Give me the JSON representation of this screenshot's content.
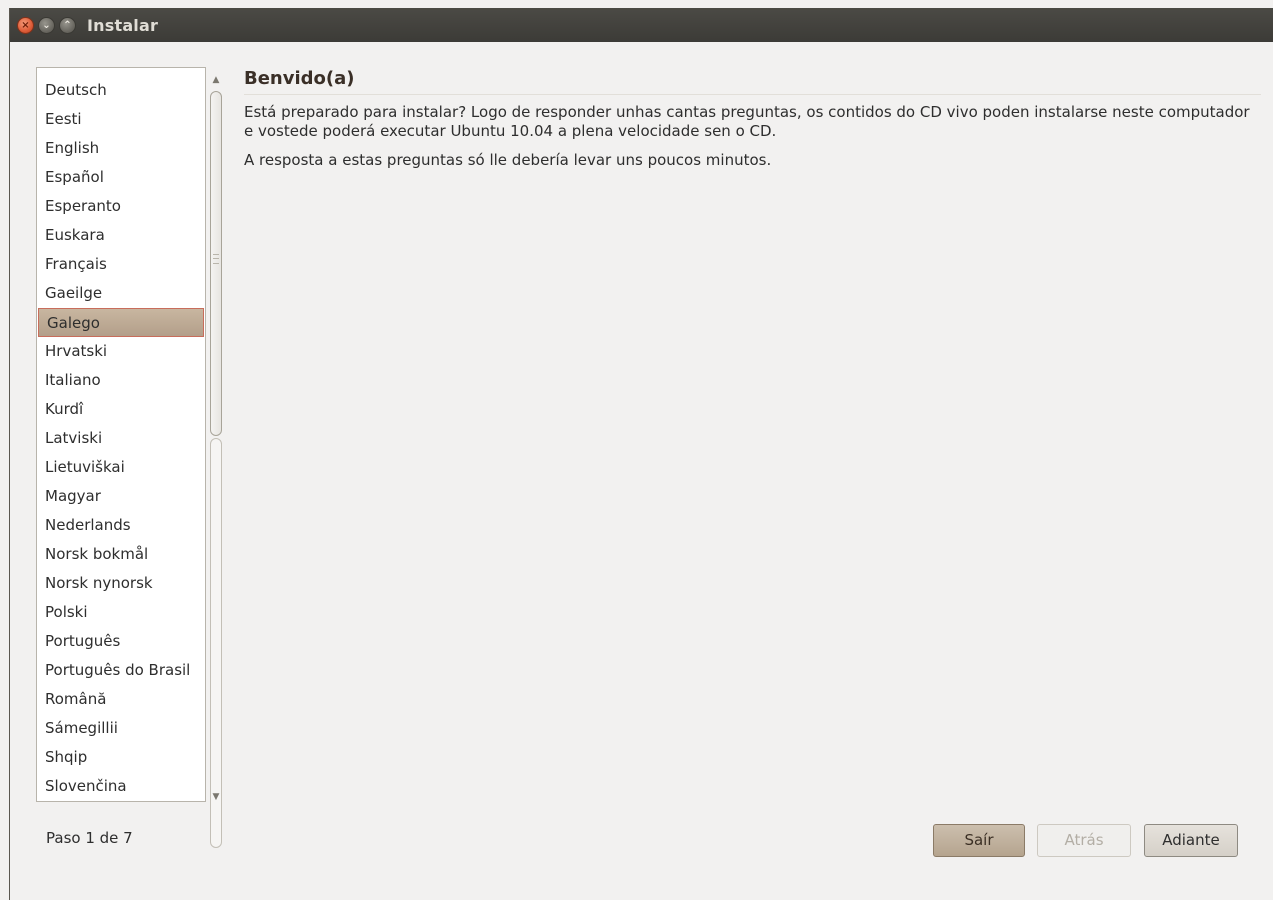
{
  "window": {
    "title": "Instalar",
    "close_glyph": "×",
    "minimize_glyph": "⌄",
    "maximize_glyph": "⌃"
  },
  "languages": [
    "Deutsch",
    "Eesti",
    "English",
    "Español",
    "Esperanto",
    "Euskara",
    "Français",
    "Gaeilge",
    "Galego",
    "Hrvatski",
    "Italiano",
    "Kurdî",
    "Latviski",
    "Lietuviškai",
    "Magyar",
    "Nederlands",
    "Norsk bokmål",
    "Norsk nynorsk",
    "Polski",
    "Português",
    "Português do Brasil",
    "Română",
    "Sámegillii",
    "Shqip",
    "Slovenčina"
  ],
  "selected_language": "Galego",
  "scroll_arrows": {
    "up": "▲",
    "down": "▼"
  },
  "content": {
    "heading": "Benvido(a)",
    "paragraph1": "Está preparado para instalar? Logo de responder unhas cantas preguntas, os contidos do CD vivo poden instalarse neste computador e vostede poderá executar Ubuntu 10.04 a plena velocidade sen o CD.",
    "paragraph2": "A resposta a estas preguntas só lle debería levar uns poucos minutos."
  },
  "footer": {
    "step": "Paso 1 de 7",
    "quit_label": "Saír",
    "back_label": "Atrás",
    "next_label": "Adiante"
  },
  "colors": {
    "titlebar": "#3c3b37",
    "selection": "#b9a590",
    "accent_close": "#e0603c"
  }
}
